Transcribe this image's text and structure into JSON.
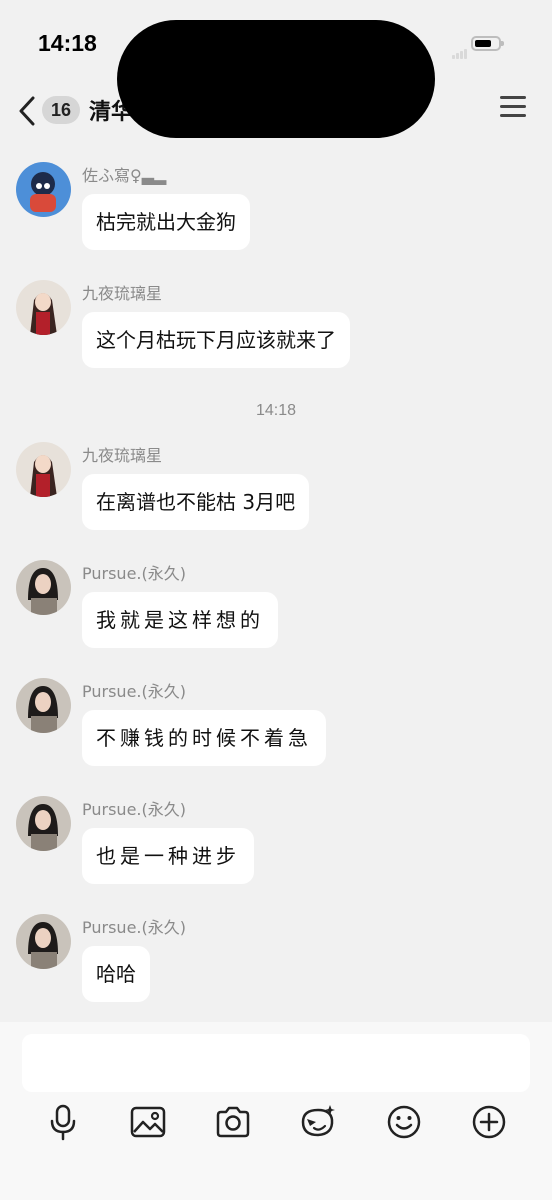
{
  "status_bar": {
    "time": "14:18"
  },
  "header": {
    "unread_count": "16",
    "group_title": "清华"
  },
  "messages": [
    {
      "sender": "佐ふ寫♀▃▂",
      "text": "枯完就出大金狗"
    },
    {
      "sender": "九夜琉璃星",
      "text": "这个月枯玩下月应该就来了"
    },
    {
      "sender": "九夜琉璃星",
      "text": "在离谱也不能枯 3月吧"
    },
    {
      "sender": "Pursue.(永久)",
      "text": "我就是这样想的"
    },
    {
      "sender": "Pursue.(永久)",
      "text": "不赚钱的时候不着急"
    },
    {
      "sender": "Pursue.(永久)",
      "text": "也是一种进步"
    },
    {
      "sender": "Pursue.(永久)",
      "text": "哈哈"
    }
  ],
  "timestamp": "14:18",
  "toolbar": {
    "icons": [
      "microphone-icon",
      "image-icon",
      "camera-icon",
      "sticker-icon",
      "emoji-icon",
      "plus-icon"
    ]
  },
  "colors": {
    "background": "#f1f1f1",
    "bubble": "#ffffff",
    "meta_text": "#8a8a8a"
  }
}
